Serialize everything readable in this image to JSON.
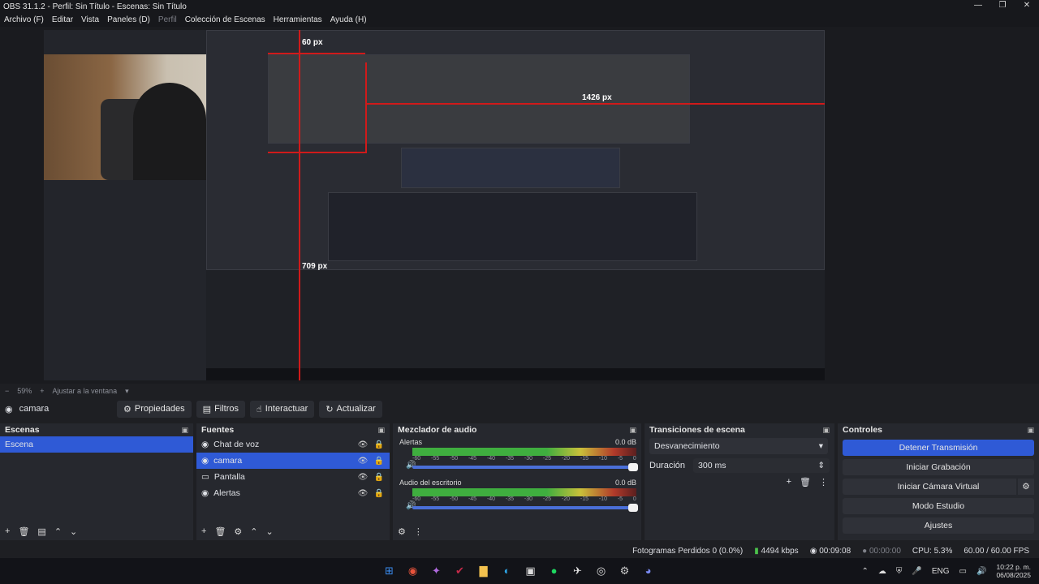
{
  "window": {
    "title": "OBS 31.1.2 - Perfil: Sin Título - Escenas: Sin Título",
    "minimize": "—",
    "maximize": "❐",
    "close": "✕"
  },
  "menu": [
    {
      "label": "Archivo (F)",
      "dim": false
    },
    {
      "label": "Editar",
      "dim": false
    },
    {
      "label": "Vista",
      "dim": false
    },
    {
      "label": "Paneles (D)",
      "dim": false
    },
    {
      "label": "Perfil",
      "dim": true
    },
    {
      "label": "Colección de Escenas",
      "dim": false
    },
    {
      "label": "Herramientas",
      "dim": false
    },
    {
      "label": "Ayuda (H)",
      "dim": false
    }
  ],
  "preview": {
    "measure_top": "60 px",
    "measure_right": "1426 px",
    "measure_left": "709 px"
  },
  "scale": {
    "zoom": "59%",
    "fit_label": "Ajustar a la ventana"
  },
  "context": {
    "source_name": "camara",
    "properties": "Propiedades",
    "filters": "Filtros",
    "interact": "Interactuar",
    "refresh": "Actualizar"
  },
  "scenes": {
    "header": "Escenas",
    "items": [
      "Escena"
    ]
  },
  "sources": {
    "header": "Fuentes",
    "items": [
      "Chat de voz",
      "camara",
      "Pantalla",
      "Alertas"
    ]
  },
  "mixer": {
    "header": "Mezclador de audio",
    "channels": [
      {
        "name": "Alertas",
        "db": "0.0 dB"
      },
      {
        "name": "Audio del escritorio",
        "db": "0.0 dB"
      }
    ],
    "ticks": [
      "-60",
      "-55",
      "-50",
      "-45",
      "-40",
      "-35",
      "-30",
      "-25",
      "-20",
      "-15",
      "-10",
      "-5",
      "0"
    ]
  },
  "transitions": {
    "header": "Transiciones de escena",
    "selected": "Desvanecimiento",
    "duration_label": "Duración",
    "duration_value": "300 ms"
  },
  "controls": {
    "header": "Controles",
    "stop_stream": "Detener Transmisión",
    "start_recording": "Iniciar Grabación",
    "start_virtual_cam": "Iniciar Cámara Virtual",
    "studio_mode": "Modo Estudio",
    "settings": "Ajustes"
  },
  "status": {
    "dropped_frames": "Fotogramas Perdidos 0 (0.0%)",
    "bitrate": "4494 kbps",
    "stream_time": "00:09:08",
    "rec_time": "00:00:00",
    "cpu": "CPU: 5.3%",
    "fps": "60.00 / 60.00 FPS"
  },
  "taskbar": {
    "lang": "ENG",
    "time": "10:22 p. m.",
    "date": "06/08/2025"
  },
  "colors": {
    "accent": "#2f5ad6",
    "panel": "#26282e",
    "background": "#1e1f23"
  }
}
